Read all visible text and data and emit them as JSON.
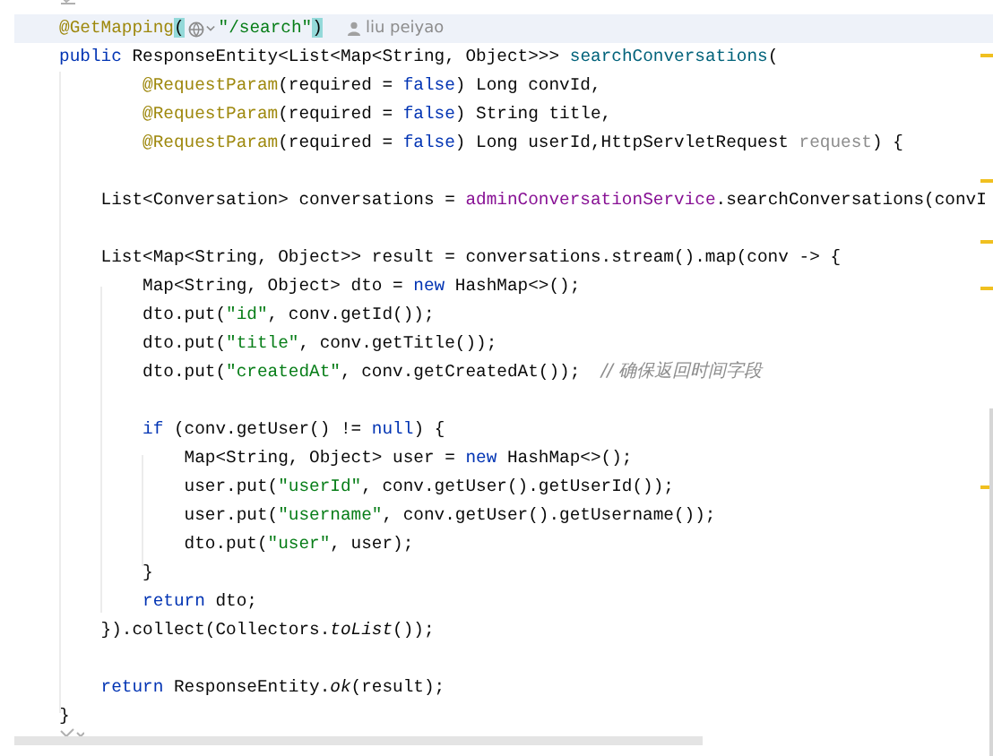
{
  "editor": {
    "lines": [
      {
        "kind": "code",
        "highlighted": true,
        "author": "liu peiyao",
        "tokens": [
          {
            "kind": "annotation",
            "text": "@GetMapping"
          },
          {
            "kind": "brace-match",
            "text": "("
          },
          {
            "kind": "globe"
          },
          {
            "kind": "string",
            "text": "\"/search\""
          },
          {
            "kind": "brace-match",
            "text": ")"
          }
        ]
      },
      {
        "kind": "code",
        "highlighted": false,
        "tokens": [
          {
            "kind": "keyword",
            "text": "public "
          },
          {
            "kind": "plain",
            "text": "ResponseEntity<List<Map<String, Object>>> "
          },
          {
            "kind": "declaration",
            "text": "searchConversations"
          },
          {
            "kind": "plain",
            "text": "("
          }
        ],
        "children": [
          {
            "kind": "continuation",
            "highlighted": false,
            "tokens": [
              {
                "kind": "annotation",
                "text": "@RequestParam"
              },
              {
                "kind": "plain",
                "text": "(required = "
              },
              {
                "kind": "keyword",
                "text": "false"
              },
              {
                "kind": "plain",
                "text": ") Long convId,"
              }
            ]
          },
          {
            "kind": "continuation",
            "highlighted": false,
            "tokens": [
              {
                "kind": "annotation",
                "text": "@RequestParam"
              },
              {
                "kind": "plain",
                "text": "(required = "
              },
              {
                "kind": "keyword",
                "text": "false"
              },
              {
                "kind": "plain",
                "text": ") String title,"
              }
            ]
          },
          {
            "kind": "continuation",
            "highlighted": false,
            "tokens": [
              {
                "kind": "annotation",
                "text": "@RequestParam"
              },
              {
                "kind": "plain",
                "text": "(required = "
              },
              {
                "kind": "keyword",
                "text": "false"
              },
              {
                "kind": "plain",
                "text": ") Long userId,HttpServletRequest "
              },
              {
                "kind": "unused",
                "text": "request"
              },
              {
                "kind": "plain",
                "text": ") {"
              }
            ]
          },
          {
            "kind": "blank"
          },
          {
            "kind": "code",
            "highlighted": false,
            "tokens": [
              {
                "kind": "plain",
                "text": "List<Conversation> conversations = "
              },
              {
                "kind": "field",
                "text": "adminConversationService"
              },
              {
                "kind": "plain",
                "text": ".searchConversations(convI"
              }
            ]
          },
          {
            "kind": "blank"
          },
          {
            "kind": "code",
            "highlighted": false,
            "tokens": [
              {
                "kind": "plain",
                "text": "List<Map<String, Object>> result = conversations.stream().map(conv -> {"
              }
            ],
            "children": [
              {
                "kind": "code",
                "highlighted": false,
                "tokens": [
                  {
                    "kind": "plain",
                    "text": "Map<String, Object> dto = "
                  },
                  {
                    "kind": "keyword",
                    "text": "new "
                  },
                  {
                    "kind": "plain",
                    "text": "HashMap<>();"
                  }
                ]
              },
              {
                "kind": "code",
                "highlighted": false,
                "tokens": [
                  {
                    "kind": "plain",
                    "text": "dto.put("
                  },
                  {
                    "kind": "string",
                    "text": "\"id\""
                  },
                  {
                    "kind": "plain",
                    "text": ", conv.getId());"
                  }
                ]
              },
              {
                "kind": "code",
                "highlighted": false,
                "tokens": [
                  {
                    "kind": "plain",
                    "text": "dto.put("
                  },
                  {
                    "kind": "string",
                    "text": "\"title\""
                  },
                  {
                    "kind": "plain",
                    "text": ", conv.getTitle());"
                  }
                ]
              },
              {
                "kind": "code",
                "highlighted": false,
                "tokens": [
                  {
                    "kind": "plain",
                    "text": "dto.put("
                  },
                  {
                    "kind": "string",
                    "text": "\"createdAt\""
                  },
                  {
                    "kind": "plain",
                    "text": ", conv.getCreatedAt());  "
                  },
                  {
                    "kind": "comment",
                    "text": "// 确保返回时间字段"
                  }
                ]
              },
              {
                "kind": "blank"
              },
              {
                "kind": "code",
                "highlighted": false,
                "tokens": [
                  {
                    "kind": "keyword",
                    "text": "if "
                  },
                  {
                    "kind": "plain",
                    "text": "(conv.getUser() != "
                  },
                  {
                    "kind": "keyword",
                    "text": "null"
                  },
                  {
                    "kind": "plain",
                    "text": ") {"
                  }
                ],
                "children": [
                  {
                    "kind": "code",
                    "highlighted": false,
                    "tokens": [
                      {
                        "kind": "plain",
                        "text": "Map<String, Object> user = "
                      },
                      {
                        "kind": "keyword",
                        "text": "new "
                      },
                      {
                        "kind": "plain",
                        "text": "HashMap<>();"
                      }
                    ]
                  },
                  {
                    "kind": "code",
                    "highlighted": false,
                    "tokens": [
                      {
                        "kind": "plain",
                        "text": "user.put("
                      },
                      {
                        "kind": "string",
                        "text": "\"userId\""
                      },
                      {
                        "kind": "plain",
                        "text": ", conv.getUser().getUserId());"
                      }
                    ]
                  },
                  {
                    "kind": "code",
                    "highlighted": false,
                    "tokens": [
                      {
                        "kind": "plain",
                        "text": "user.put("
                      },
                      {
                        "kind": "string",
                        "text": "\"username\""
                      },
                      {
                        "kind": "plain",
                        "text": ", conv.getUser().getUsername());"
                      }
                    ]
                  },
                  {
                    "kind": "code",
                    "highlighted": false,
                    "tokens": [
                      {
                        "kind": "plain",
                        "text": "dto.put("
                      },
                      {
                        "kind": "string",
                        "text": "\"user\""
                      },
                      {
                        "kind": "plain",
                        "text": ", user);"
                      }
                    ]
                  }
                ]
              },
              {
                "kind": "code",
                "highlighted": false,
                "tokens": [
                  {
                    "kind": "plain",
                    "text": "}"
                  }
                ]
              },
              {
                "kind": "code",
                "highlighted": false,
                "tokens": [
                  {
                    "kind": "keyword",
                    "text": "return "
                  },
                  {
                    "kind": "plain",
                    "text": "dto;"
                  }
                ]
              }
            ]
          },
          {
            "kind": "code",
            "highlighted": false,
            "tokens": [
              {
                "kind": "plain",
                "text": "}).collect(Collectors."
              },
              {
                "kind": "static",
                "text": "toList"
              },
              {
                "kind": "plain",
                "text": "());"
              }
            ]
          },
          {
            "kind": "blank"
          },
          {
            "kind": "code",
            "highlighted": false,
            "tokens": [
              {
                "kind": "keyword",
                "text": "return "
              },
              {
                "kind": "plain",
                "text": "ResponseEntity."
              },
              {
                "kind": "static",
                "text": "ok"
              },
              {
                "kind": "plain",
                "text": "(result);"
              }
            ]
          }
        ]
      },
      {
        "kind": "code",
        "highlighted": false,
        "tokens": [
          {
            "kind": "plain",
            "text": "}"
          }
        ]
      }
    ]
  }
}
